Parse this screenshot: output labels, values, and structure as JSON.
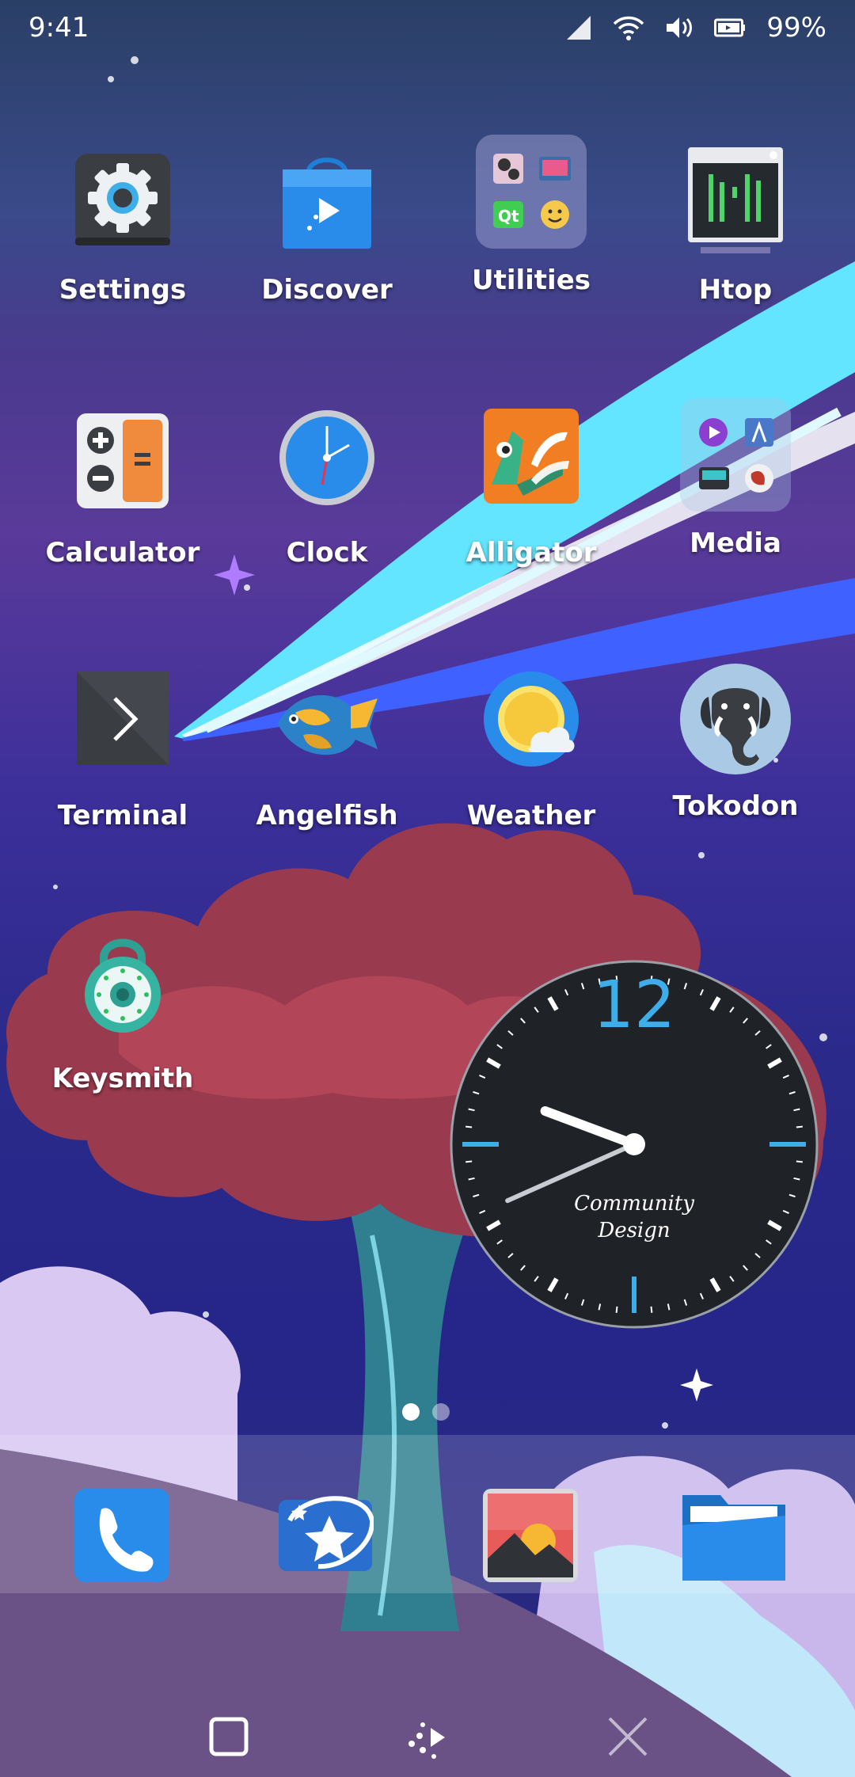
{
  "status_bar": {
    "time": "9:41",
    "battery_percent": "99%",
    "icons": [
      "signal-icon",
      "wifi-icon",
      "volume-icon",
      "battery-icon"
    ]
  },
  "apps": [
    {
      "label": "Settings",
      "icon": "gear-icon"
    },
    {
      "label": "Discover",
      "icon": "shopping-bag-icon"
    },
    {
      "label": "Utilities",
      "icon": "folder-icon"
    },
    {
      "label": "Htop",
      "icon": "terminal-monitor-icon"
    },
    {
      "label": "Calculator",
      "icon": "calculator-icon"
    },
    {
      "label": "Clock",
      "icon": "clock-icon"
    },
    {
      "label": "Alligator",
      "icon": "alligator-icon"
    },
    {
      "label": "Media",
      "icon": "folder-icon"
    },
    {
      "label": "Terminal",
      "icon": "terminal-icon"
    },
    {
      "label": "Angelfish",
      "icon": "fish-icon"
    },
    {
      "label": "Weather",
      "icon": "sun-cloud-icon"
    },
    {
      "label": "Tokodon",
      "icon": "elephant-icon"
    },
    {
      "label": "Keysmith",
      "icon": "padlock-icon"
    }
  ],
  "utilities_folder": {
    "qt_label": "Qt"
  },
  "clock_widget": {
    "numeral": "12",
    "brand_line1": "Community",
    "brand_line2": "Design",
    "time_shown": "9:41"
  },
  "pager": {
    "pages": 2,
    "current": 1
  },
  "dock": [
    "phone-icon",
    "dialer-star-icon",
    "photos-icon",
    "files-icon"
  ],
  "navigation": [
    "overview-icon",
    "home-dots-icon",
    "close-icon"
  ],
  "colors": {
    "accent": "#3daee9",
    "dock_bg": "rgba(255,255,255,0.16)"
  }
}
